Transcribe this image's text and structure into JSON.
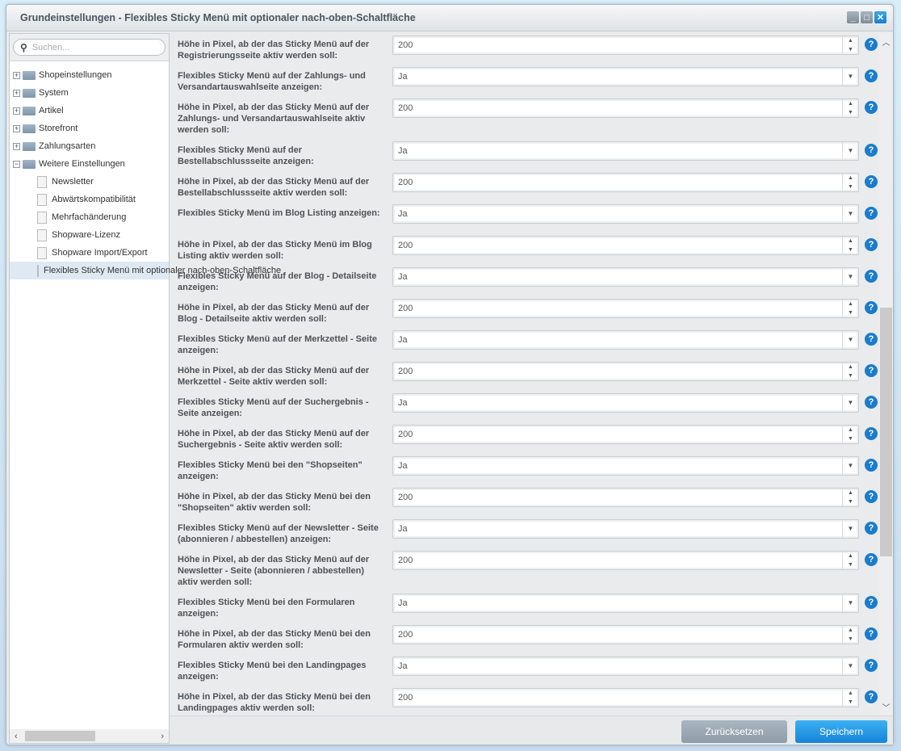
{
  "window": {
    "title": "Grundeinstellungen - Flexibles Sticky Menü mit optionaler nach-oben-Schaltfläche"
  },
  "sidebar": {
    "search_placeholder": "Suchen...",
    "tree": [
      {
        "label": "Shopeinstellungen",
        "level": 0,
        "expanded": false
      },
      {
        "label": "System",
        "level": 0,
        "expanded": false
      },
      {
        "label": "Artikel",
        "level": 0,
        "expanded": false
      },
      {
        "label": "Storefront",
        "level": 0,
        "expanded": false
      },
      {
        "label": "Zahlungsarten",
        "level": 0,
        "expanded": false
      },
      {
        "label": "Weitere Einstellungen",
        "level": 0,
        "expanded": true
      },
      {
        "label": "Newsletter",
        "level": 1
      },
      {
        "label": "Abwärtskompatibilität",
        "level": 1
      },
      {
        "label": "Mehrfachänderung",
        "level": 1
      },
      {
        "label": "Shopware-Lizenz",
        "level": 1
      },
      {
        "label": "Shopware Import/Export",
        "level": 1
      },
      {
        "label": "Flexibles Sticky Menü mit optionaler nach-oben-Schaltfläche",
        "level": 1,
        "selected": true
      }
    ]
  },
  "form": {
    "rows": [
      {
        "label": "Höhe in Pixel, ab der das Sticky Menü auf der Registrierungsseite aktiv werden soll:",
        "type": "number",
        "value": "200"
      },
      {
        "label": "Flexibles Sticky Menü auf der Zahlungs- und Versandartauswahlseite anzeigen:",
        "type": "select",
        "value": "Ja"
      },
      {
        "label": "Höhe in Pixel, ab der das Sticky Menü auf der Zahlungs- und Versandartauswahlseite aktiv werden soll:",
        "type": "number",
        "value": "200"
      },
      {
        "label": "Flexibles Sticky Menü auf der Bestellabschlussseite anzeigen:",
        "type": "select",
        "value": "Ja"
      },
      {
        "label": "Höhe in Pixel, ab der das Sticky Menü auf der Bestellabschlussseite aktiv werden soll:",
        "type": "number",
        "value": "200"
      },
      {
        "label": "Flexibles Sticky Menü im Blog Listing anzeigen:",
        "type": "select",
        "value": "Ja"
      },
      {
        "label": "Höhe in Pixel, ab der das Sticky Menü im Blog Listing aktiv werden soll:",
        "type": "number",
        "value": "200"
      },
      {
        "label": "Flexibles Sticky Menü auf der Blog - Detailseite anzeigen:",
        "type": "select",
        "value": "Ja"
      },
      {
        "label": "Höhe in Pixel, ab der das Sticky Menü auf der Blog - Detailseite aktiv werden soll:",
        "type": "number",
        "value": "200"
      },
      {
        "label": "Flexibles Sticky Menü auf der Merkzettel - Seite anzeigen:",
        "type": "select",
        "value": "Ja"
      },
      {
        "label": "Höhe in Pixel, ab der das Sticky Menü auf der Merkzettel - Seite aktiv werden soll:",
        "type": "number",
        "value": "200"
      },
      {
        "label": "Flexibles Sticky Menü auf der Suchergebnis - Seite anzeigen:",
        "type": "select",
        "value": "Ja"
      },
      {
        "label": "Höhe in Pixel, ab der das Sticky Menü auf der Suchergebnis - Seite aktiv werden soll:",
        "type": "number",
        "value": "200"
      },
      {
        "label": "Flexibles Sticky Menü bei den \"Shopseiten\" anzeigen:",
        "type": "select",
        "value": "Ja"
      },
      {
        "label": "Höhe in Pixel, ab der das Sticky Menü bei den \"Shopseiten\" aktiv werden soll:",
        "type": "number",
        "value": "200"
      },
      {
        "label": "Flexibles Sticky Menü auf der Newsletter - Seite (abonnieren / abbestellen) anzeigen:",
        "type": "select",
        "value": "Ja"
      },
      {
        "label": "Höhe in Pixel, ab der das Sticky Menü auf der Newsletter - Seite (abonnieren / abbestellen) aktiv werden soll:",
        "type": "number",
        "value": "200"
      },
      {
        "label": "Flexibles Sticky Menü bei den Formularen anzeigen:",
        "type": "select",
        "value": "Ja"
      },
      {
        "label": "Höhe in Pixel, ab der das Sticky Menü bei den Formularen aktiv werden soll:",
        "type": "number",
        "value": "200"
      },
      {
        "label": "Flexibles Sticky Menü bei den Landingpages anzeigen:",
        "type": "select",
        "value": "Ja"
      },
      {
        "label": "Höhe in Pixel, ab der das Sticky Menü bei den Landingpages aktiv werden soll:",
        "type": "number",
        "value": "200"
      }
    ]
  },
  "footer": {
    "reset_label": "Zurücksetzen",
    "save_label": "Speichern"
  },
  "colors": {
    "accent": "#1a7ccc",
    "save_button": "#1f8fe0",
    "reset_button": "#9aa8b3"
  },
  "scroll": {
    "vertical_position_percent": 62
  }
}
